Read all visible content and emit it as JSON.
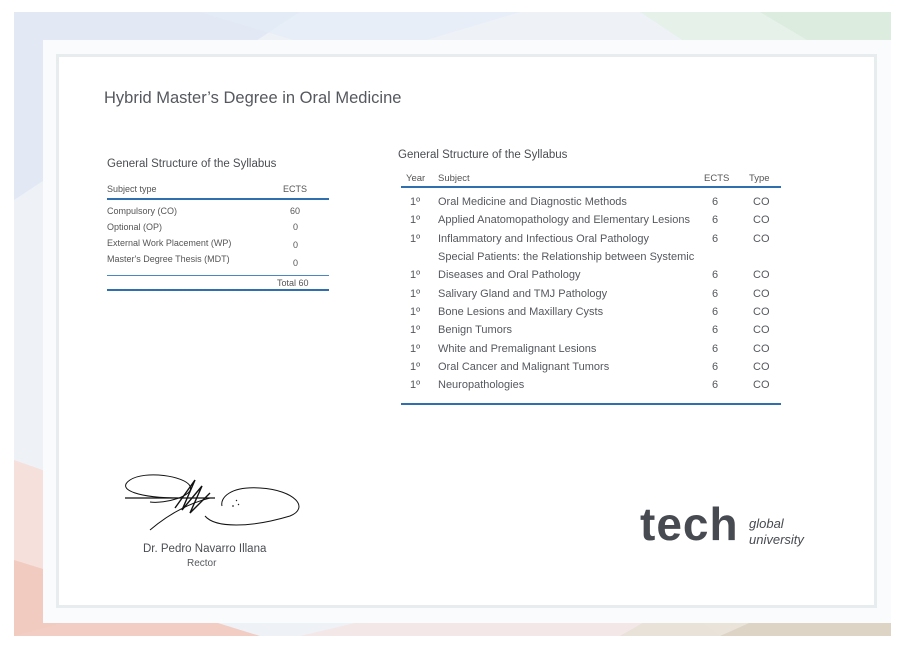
{
  "title": "Hybrid Master’s Degree in Oral Medicine",
  "summary": {
    "heading": "General Structure of the Syllabus",
    "col_type": "Subject type",
    "col_ects": "ECTS",
    "rows": [
      {
        "type": "Compulsory (CO)",
        "ects": "60"
      },
      {
        "type": "Optional (OP)",
        "ects": "0"
      },
      {
        "type": "External Work Placement (WP)",
        "ects": "0"
      },
      {
        "type": "Master's Degree Thesis (MDT)",
        "ects": "0"
      }
    ],
    "total": "Total 60"
  },
  "syllabus": {
    "heading": "General Structure of the Syllabus",
    "columns": {
      "year": "Year",
      "subject": "Subject",
      "ects": "ECTS",
      "type": "Type"
    },
    "rows": [
      {
        "year": "1º",
        "subject": "Oral Medicine and Diagnostic Methods",
        "ects": "6",
        "type": "CO"
      },
      {
        "year": "1º",
        "subject": "Applied Anatomopathology and Elementary Lesions",
        "ects": "6",
        "type": "CO"
      },
      {
        "year": "1º",
        "subject": "Inflammatory and Infectious Oral Pathology",
        "ects": "6",
        "type": "CO"
      },
      {
        "year": "",
        "subject": "Special Patients: the Relationship between Systemic",
        "ects": "",
        "type": ""
      },
      {
        "year": "1º",
        "subject": "Diseases and Oral Pathology",
        "ects": "6",
        "type": "CO"
      },
      {
        "year": "1º",
        "subject": "Salivary Gland and TMJ Pathology",
        "ects": "6",
        "type": "CO"
      },
      {
        "year": "1º",
        "subject": "Bone Lesions and Maxillary Cysts",
        "ects": "6",
        "type": "CO"
      },
      {
        "year": "1º",
        "subject": "Benign Tumors",
        "ects": "6",
        "type": "CO"
      },
      {
        "year": "1º",
        "subject": "White and Premalignant Lesions",
        "ects": "6",
        "type": "CO"
      },
      {
        "year": "1º",
        "subject": "Oral Cancer and Malignant Tumors",
        "ects": "6",
        "type": "CO"
      },
      {
        "year": "1º",
        "subject": "Neuropathologies",
        "ects": "6",
        "type": "CO"
      }
    ]
  },
  "signer": {
    "name": "Dr. Pedro Navarro Illana",
    "role": "Rector"
  },
  "logo": {
    "word": "tech",
    "line1": "global",
    "line2": "university"
  },
  "colors": {
    "rule_blue": "#2f6fad",
    "text_gray": "#55585e"
  }
}
